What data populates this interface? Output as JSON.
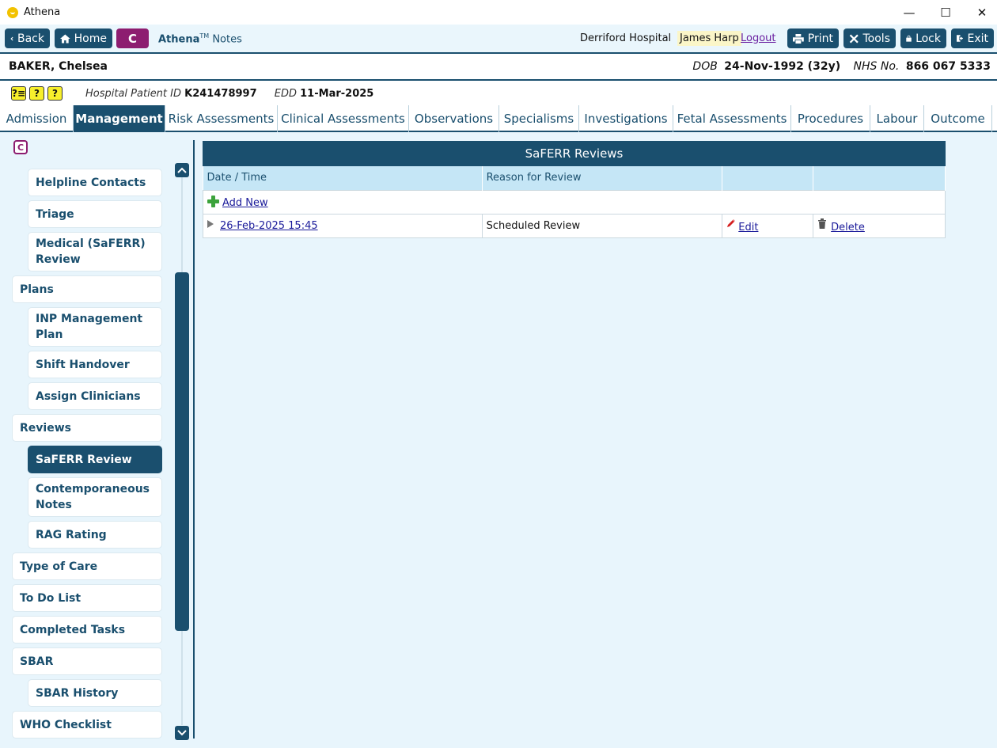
{
  "window": {
    "title": "Athena",
    "controls": {
      "minimize": "—",
      "maximize": "☐",
      "close": "✕"
    }
  },
  "toolbar": {
    "back": "Back",
    "home": "Home",
    "c_button": "C",
    "app_name": "Athena",
    "app_tm": "TM",
    "app_module": "Notes",
    "hospital": "Derriford Hospital",
    "user": "James Harp",
    "logout": "Logout",
    "print": "Print",
    "tools": "Tools",
    "lock": "Lock",
    "exit": "Exit"
  },
  "patient": {
    "name": "BAKER, Chelsea",
    "dob_label": "DOB",
    "dob_value": "24-Nov-1992 (32y)",
    "nhs_label": "NHS No.",
    "nhs_value": "866 067 5333",
    "hospital_id_label": "Hospital Patient ID",
    "hospital_id_value": "K241478997",
    "edd_label": "EDD",
    "edd_value": "11-Mar-2025",
    "alert_icons": [
      "?≡",
      "?",
      "?"
    ]
  },
  "tabs": [
    "Admission",
    "Management",
    "Risk Assessments",
    "Clinical Assessments",
    "Observations",
    "Specialisms",
    "Investigations",
    "Fetal Assessments",
    "Procedures",
    "Labour",
    "Outcome"
  ],
  "active_tab": "Management",
  "sidebar": {
    "icon_letter": "C",
    "items": [
      {
        "label": "Helpline Contacts",
        "level": 2
      },
      {
        "label": "Triage",
        "level": 2
      },
      {
        "label": "Medical (SaFERR) Review",
        "level": 2
      },
      {
        "label": "Plans",
        "level": 1
      },
      {
        "label": "INP Management Plan",
        "level": 2
      },
      {
        "label": "Shift Handover",
        "level": 2
      },
      {
        "label": "Assign Clinicians",
        "level": 2
      },
      {
        "label": "Reviews",
        "level": 1
      },
      {
        "label": "SaFERR Review",
        "level": 2,
        "active": true
      },
      {
        "label": "Contemporaneous Notes",
        "level": 2
      },
      {
        "label": "RAG Rating",
        "level": 2
      },
      {
        "label": "Type of Care",
        "level": 1
      },
      {
        "label": "To Do List",
        "level": 1
      },
      {
        "label": "Completed Tasks",
        "level": 1
      },
      {
        "label": "SBAR",
        "level": 1
      },
      {
        "label": "SBAR History",
        "level": 2
      },
      {
        "label": "WHO Checklist",
        "level": 1
      }
    ]
  },
  "reviews_panel": {
    "title": "SaFERR Reviews",
    "columns": [
      "Date / Time",
      "Reason for Review",
      "",
      ""
    ],
    "add_new": "Add New",
    "rows": [
      {
        "datetime": "26-Feb-2025 15:45",
        "reason": "Scheduled Review",
        "edit": "Edit",
        "delete": "Delete"
      }
    ]
  },
  "colors": {
    "primary": "#1a4f6e",
    "accent_purple": "#8d1d70",
    "background": "#e8f5fc",
    "header_row": "#c5e6f6",
    "alert_yellow": "#f7ef2c"
  }
}
